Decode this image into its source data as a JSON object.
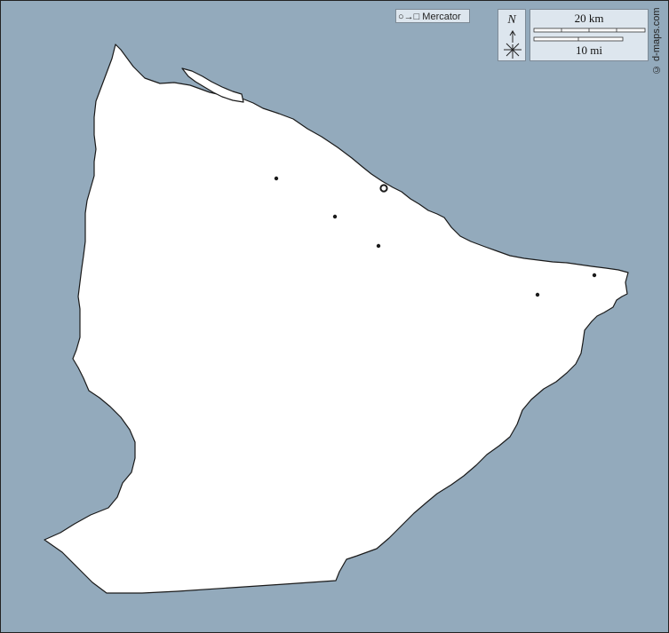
{
  "map": {
    "colors": {
      "sea": "#93aabc",
      "land": "#ffffff",
      "coastline": "#1a1a1a",
      "panel": "#dde6ee"
    },
    "markers": [
      {
        "name": "town-marker",
        "style": "dot"
      },
      {
        "name": "town-marker",
        "style": "dot"
      },
      {
        "name": "town-marker",
        "style": "dot"
      },
      {
        "name": "town-marker",
        "style": "dot"
      },
      {
        "name": "town-marker",
        "style": "dot"
      },
      {
        "name": "capital-marker",
        "style": "ring"
      }
    ]
  },
  "projection": {
    "glyphs": "○→□",
    "name": "Mercator"
  },
  "north_arrow": {
    "letter": "N"
  },
  "scale": {
    "km_label": "20 km",
    "mi_label": "10 mi"
  },
  "credit": {
    "text": "© d-maps.com"
  }
}
